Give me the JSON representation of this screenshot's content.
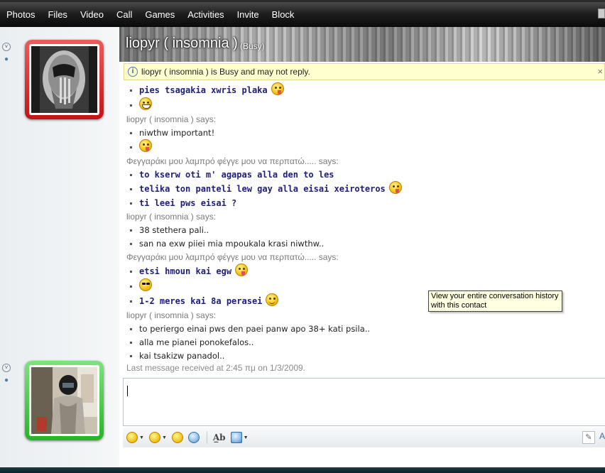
{
  "menu": {
    "items": [
      "Photos",
      "Files",
      "Video",
      "Call",
      "Games",
      "Activities",
      "Invite",
      "Block"
    ]
  },
  "contact": {
    "name": "liopyr ( insomnia )",
    "status": "(Busy)"
  },
  "infobar": {
    "text": "liopyr ( insomnia ) is Busy and may not reply.",
    "close": "×"
  },
  "conversation": [
    {
      "kind": "msg",
      "style": "b",
      "text": "pies tsagakia xwris plaka",
      "emoticon": "tongue-icon"
    },
    {
      "kind": "msg",
      "style": "b",
      "text": "",
      "emoticon": "grin-icon"
    },
    {
      "kind": "says",
      "text": "liopyr ( insomnia ) says:"
    },
    {
      "kind": "msg",
      "style": "n",
      "text": "niwthw important!"
    },
    {
      "kind": "msg",
      "style": "n",
      "text": "",
      "emoticon": "tongue-icon"
    },
    {
      "kind": "says",
      "text": "Φεγγαράκι μου λαμπρό φέγγε μου να περπατώ..... says:"
    },
    {
      "kind": "msg",
      "style": "b",
      "text": "to kserw oti m' agapas alla den to les"
    },
    {
      "kind": "msg",
      "style": "b",
      "text": "telika ton panteli lew gay alla eisai xeiroteros",
      "emoticon": "tongue-icon"
    },
    {
      "kind": "msg",
      "style": "b",
      "text": "ti leei pws eisai ?"
    },
    {
      "kind": "says",
      "text": "liopyr ( insomnia ) says:"
    },
    {
      "kind": "msg",
      "style": "n",
      "text": "38 stethera pali.."
    },
    {
      "kind": "msg",
      "style": "n",
      "text": "san na exw piiei mia mpoukala krasi niwthw.."
    },
    {
      "kind": "says",
      "text": "Φεγγαράκι μου λαμπρό φέγγε μου να περπατώ..... says:"
    },
    {
      "kind": "msg",
      "style": "b",
      "text": "etsi hmoun kai egw",
      "emoticon": "tongue-icon"
    },
    {
      "kind": "msg",
      "style": "b",
      "text": "",
      "emoticon": "cool-icon"
    },
    {
      "kind": "msg",
      "style": "b",
      "text": "1-2 meres kai 8a perasei",
      "emoticon": "smile-icon"
    },
    {
      "kind": "says",
      "text": "liopyr ( insomnia ) says:"
    },
    {
      "kind": "msg",
      "style": "n",
      "text": "to periergo einai pws den paei panw apo 38+ kati psila.."
    },
    {
      "kind": "msg",
      "style": "n",
      "text": "alla me pianei ponokefalos.."
    },
    {
      "kind": "msg",
      "style": "n",
      "text": "kai tsakizw panadol.."
    }
  ],
  "last_message": "Last message received at 2:45 πμ on 1/3/2009.",
  "tooltip": {
    "line1": "View your entire conversation history",
    "line2": "with this contact"
  },
  "compose": {
    "value": ""
  },
  "toolbar": {
    "icons": [
      "emoticon-icon",
      "wink-icon",
      "voice-clip-icon",
      "nudge-icon",
      "font-icon",
      "background-icon"
    ],
    "font_label": "A̲b",
    "handwriting": "✎"
  },
  "colors": {
    "own_text": "#1d1d7d",
    "contact_frame_busy": "#d42020",
    "own_frame_online": "#34c234",
    "infobar_bg": "#ffffcf"
  }
}
